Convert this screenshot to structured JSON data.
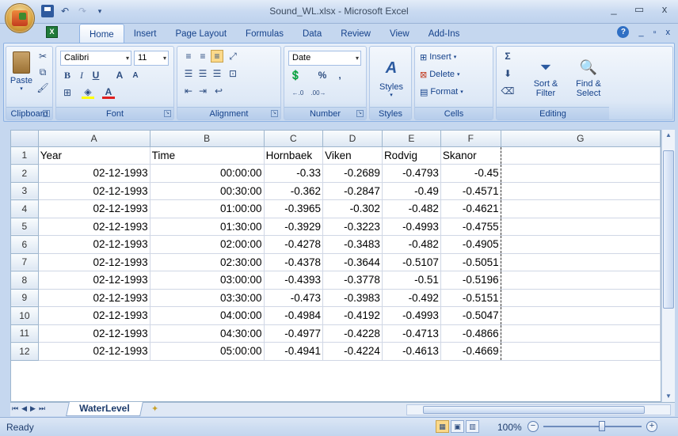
{
  "window": {
    "title": "Sound_WL.xlsx - Microsoft Excel",
    "minimize": "_",
    "maximize": "▭",
    "close": "x"
  },
  "ribbon_tabs": [
    "Home",
    "Insert",
    "Page Layout",
    "Formulas",
    "Data",
    "Review",
    "View",
    "Add-Ins"
  ],
  "ribbon": {
    "clipboard": {
      "label": "Clipboard",
      "paste": "Paste"
    },
    "font": {
      "label": "Font",
      "name": "Calibri",
      "size": "11"
    },
    "alignment": {
      "label": "Alignment"
    },
    "number": {
      "label": "Number",
      "format": "Date",
      "pct": "%",
      "comma": ","
    },
    "styles": {
      "label": "Styles"
    },
    "cells": {
      "label": "Cells",
      "insert": "Insert",
      "delete": "Delete",
      "format": "Format"
    },
    "editing": {
      "label": "Editing",
      "sort": "Sort &",
      "filter": "Filter",
      "find": "Find &",
      "select": "Select"
    }
  },
  "columns": [
    "A",
    "B",
    "C",
    "D",
    "E",
    "F",
    "G"
  ],
  "header_row": [
    "Year",
    "Time",
    "Hornbaek",
    "Viken",
    "Rodvig",
    "Skanor"
  ],
  "rows": [
    [
      "02-12-1993",
      "00:00:00",
      "-0.33",
      "-0.2689",
      "-0.4793",
      "-0.45"
    ],
    [
      "02-12-1993",
      "00:30:00",
      "-0.362",
      "-0.2847",
      "-0.49",
      "-0.4571"
    ],
    [
      "02-12-1993",
      "01:00:00",
      "-0.3965",
      "-0.302",
      "-0.482",
      "-0.4621"
    ],
    [
      "02-12-1993",
      "01:30:00",
      "-0.3929",
      "-0.3223",
      "-0.4993",
      "-0.4755"
    ],
    [
      "02-12-1993",
      "02:00:00",
      "-0.4278",
      "-0.3483",
      "-0.482",
      "-0.4905"
    ],
    [
      "02-12-1993",
      "02:30:00",
      "-0.4378",
      "-0.3644",
      "-0.5107",
      "-0.5051"
    ],
    [
      "02-12-1993",
      "03:00:00",
      "-0.4393",
      "-0.3778",
      "-0.51",
      "-0.5196"
    ],
    [
      "02-12-1993",
      "03:30:00",
      "-0.473",
      "-0.3983",
      "-0.492",
      "-0.5151"
    ],
    [
      "02-12-1993",
      "04:00:00",
      "-0.4984",
      "-0.4192",
      "-0.4993",
      "-0.5047"
    ],
    [
      "02-12-1993",
      "04:30:00",
      "-0.4977",
      "-0.4228",
      "-0.4713",
      "-0.4866"
    ],
    [
      "02-12-1993",
      "05:00:00",
      "-0.4941",
      "-0.4224",
      "-0.4613",
      "-0.4669"
    ]
  ],
  "sheet_tab": "WaterLevel",
  "status": {
    "text": "Ready",
    "zoom": "100%"
  }
}
